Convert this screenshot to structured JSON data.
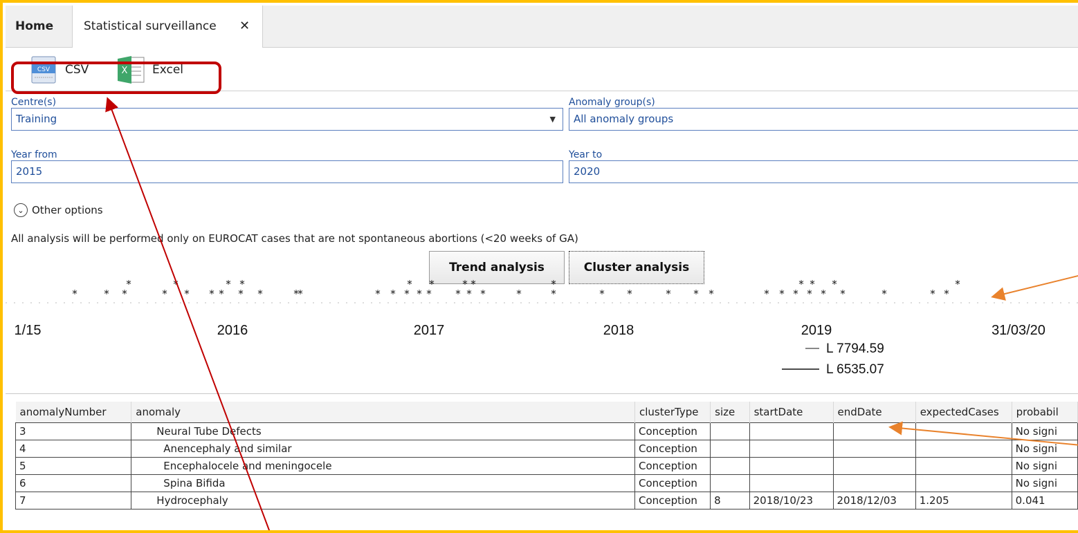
{
  "tabs": {
    "home": "Home",
    "active": "Statistical surveillance",
    "close_glyph": "✕"
  },
  "toolbar": {
    "csv_label": "CSV",
    "excel_label": "Excel"
  },
  "filters": {
    "centre_label": "Centre(s)",
    "centre_value": "Training",
    "anomaly_label": "Anomaly group(s)",
    "anomaly_value": "All anomaly groups",
    "year_from_label": "Year from",
    "year_from_value": "2015",
    "year_to_label": "Year to",
    "year_to_value": "2020"
  },
  "other_options": "Other options",
  "note": "All analysis will be performed only on EUROCAT cases that are not spontaneous abortions (<20 weeks of GA)",
  "buttons": {
    "trend": "Trend analysis",
    "cluster": "Cluster analysis"
  },
  "timeline": {
    "tick_labels": [
      "1/15",
      "2016",
      "2017",
      "2018",
      "2019",
      "31/03/20"
    ],
    "legend": [
      "L 7794.59",
      "L 6535.07"
    ]
  },
  "table": {
    "columns": [
      "anomalyNumber",
      "anomaly",
      "clusterType",
      "size",
      "startDate",
      "endDate",
      "expectedCases",
      "probabil"
    ],
    "rows": [
      {
        "num": "3",
        "anomaly": "Neural Tube Defects",
        "level": 1,
        "type": "Conception",
        "size": "",
        "start": "",
        "end": "",
        "expected": "",
        "prob": "No signi"
      },
      {
        "num": "4",
        "anomaly": "Anencephaly and similar",
        "level": 2,
        "type": "Conception",
        "size": "",
        "start": "",
        "end": "",
        "expected": "",
        "prob": "No signi"
      },
      {
        "num": "5",
        "anomaly": "Encephalocele and meningocele",
        "level": 2,
        "type": "Conception",
        "size": "",
        "start": "",
        "end": "",
        "expected": "",
        "prob": "No signi"
      },
      {
        "num": "6",
        "anomaly": "Spina Bifida",
        "level": 2,
        "type": "Conception",
        "size": "",
        "start": "",
        "end": "",
        "expected": "",
        "prob": "No signi"
      },
      {
        "num": "7",
        "anomaly": "Hydrocephaly",
        "level": 1,
        "type": "Conception",
        "size": "8",
        "start": "2018/10/23",
        "end": "2018/12/03",
        "expected": "1.205",
        "prob": "0.041"
      }
    ]
  }
}
